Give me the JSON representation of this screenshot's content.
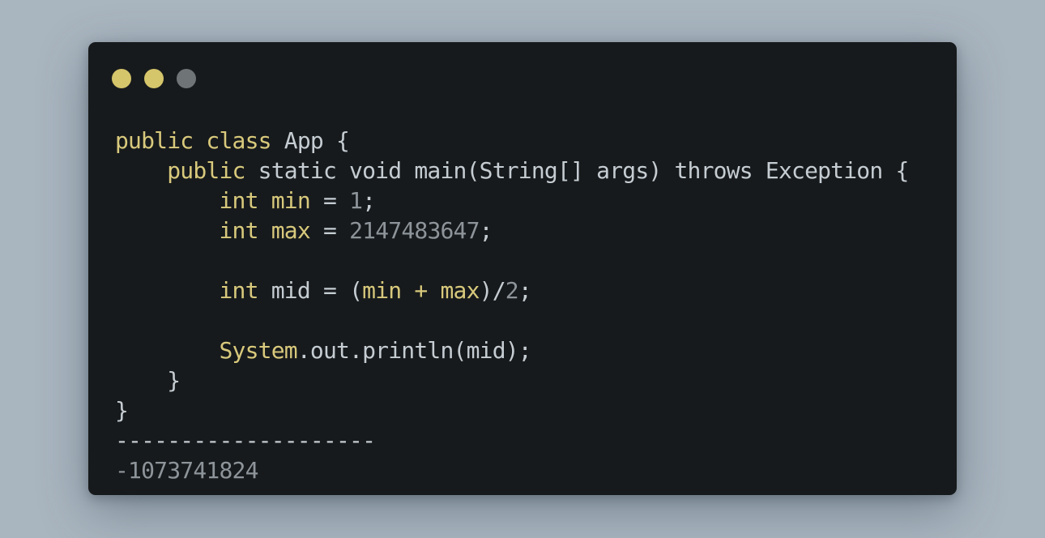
{
  "window_controls": {
    "colors": [
      "#d5c56b",
      "#d5c56b",
      "#6f7477"
    ]
  },
  "code": {
    "l1": {
      "kw1": "public",
      "kw2": "class",
      "name": "App",
      "brace": "{"
    },
    "l2": {
      "kw1": "public",
      "rest": "static void main(String[] args) throws Exception {"
    },
    "l3": {
      "kw": "int",
      "var": "min",
      "eq": "=",
      "num": "1",
      "semi": ";"
    },
    "l4": {
      "kw": "int",
      "var": "max",
      "eq": "=",
      "num": "2147483647",
      "semi": ";"
    },
    "l6": {
      "kw": "int",
      "mid": "mid = ",
      "open": "(",
      "expr": "min + max",
      "close": ")/",
      "num": "2",
      "semi": ";"
    },
    "l8": {
      "sys": "System",
      "rest": ".out.println(mid);"
    },
    "l9": {
      "brace": "}"
    },
    "l10": {
      "brace": "}"
    },
    "separator": "--------------------",
    "output": "-1073741824"
  }
}
